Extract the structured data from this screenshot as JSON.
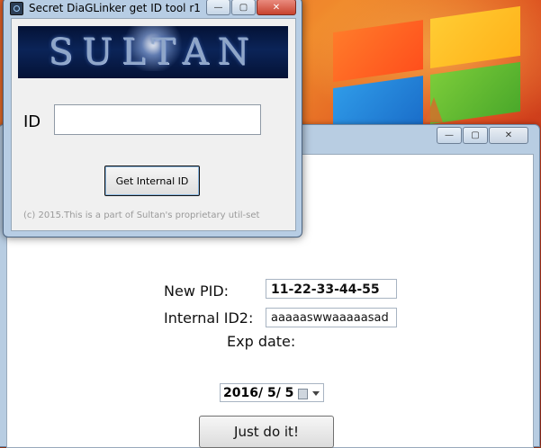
{
  "desktop": {
    "colors": {
      "accent_orange": "#e9612a",
      "accent_red": "#9e2b18"
    }
  },
  "main_window": {
    "controls": {
      "minimize": "—",
      "maximize": "▢",
      "close": "✕"
    },
    "form": {
      "new_pid_label": "New PID:",
      "new_pid_value": "11-22-33-44-55",
      "internal_id2_label": "Internal ID2:",
      "internal_id2_value": "aaaaaswwaaaaasad",
      "exp_date_label": "Exp  date:",
      "exp_date_value": "2016/  5/  5",
      "submit_button": "Just do it!"
    }
  },
  "tool_window": {
    "title": "Secret DiaGLinker get ID tool r1",
    "controls": {
      "minimize": "—",
      "maximize": "▢",
      "close": "✕"
    },
    "banner_text": "SULTAN",
    "id_label": "ID",
    "id_value": "",
    "get_button": "Get Internal ID",
    "footer": "(c) 2015.This is a part of Sultan's proprietary util-set"
  }
}
